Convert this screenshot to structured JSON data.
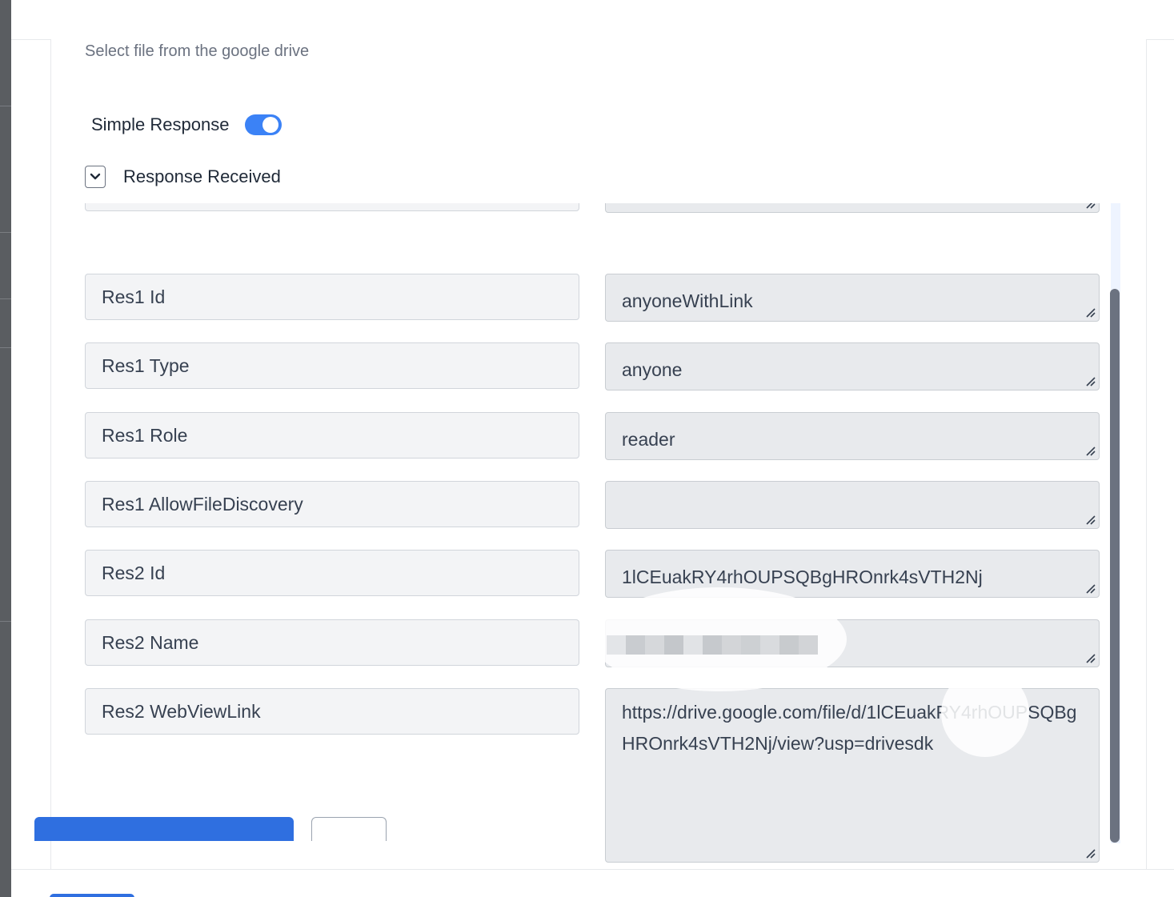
{
  "panel": {
    "hint": "Select file from the google drive"
  },
  "simple_response": {
    "label": "Simple Response",
    "enabled": true
  },
  "response_received": {
    "label": "Response Received",
    "expanded": true
  },
  "fields": [
    {
      "key": "Res1 Id",
      "value": "anyoneWithLink"
    },
    {
      "key": "Res1 Type",
      "value": "anyone"
    },
    {
      "key": "Res1 Role",
      "value": "reader"
    },
    {
      "key": "Res1 AllowFileDiscovery",
      "value": ""
    },
    {
      "key": "Res2 Id",
      "value": "1lCEuakRY4rhOUPSQBgHROnrk4sVTH2Nj"
    },
    {
      "key": "Res2 Name",
      "value": ""
    },
    {
      "key": "Res2 WebViewLink",
      "value": "https://drive.google.com/file/d/1lCEuakRY4rhOUPSQBgHROnrk4sVTH2Nj/view?usp=drivesdk"
    }
  ],
  "colors": {
    "accent": "#3b82f6",
    "primary_button": "#2f6fe0",
    "field_key_bg": "#f3f4f6",
    "field_value_bg": "#e8eaed"
  }
}
